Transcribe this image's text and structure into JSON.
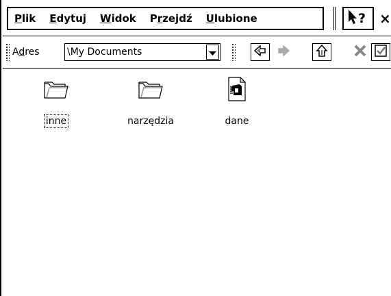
{
  "menu": {
    "items": [
      {
        "first": "P",
        "rest": "lik"
      },
      {
        "first": "E",
        "rest": "dytuj"
      },
      {
        "first": "W",
        "rest": "idok"
      },
      {
        "pre": "P",
        "first": "r",
        "rest": "zejdź"
      },
      {
        "first": "U",
        "rest": "lubione"
      }
    ],
    "help_icon": "help-cursor-icon",
    "close_glyph": "×"
  },
  "address": {
    "label_pre": "A",
    "label_ul": "d",
    "label_post": "res",
    "value": "\\My Documents",
    "dropdown_icon": "chevron-down-icon"
  },
  "toolbar": {
    "buttons": [
      "back-icon",
      "forward-icon",
      "up-folder-icon",
      "delete-icon",
      "properties-icon"
    ]
  },
  "files": [
    {
      "name": "inne",
      "icon": "folder-icon",
      "focused": true
    },
    {
      "name": "narzędzia",
      "icon": "folder-icon",
      "focused": false
    },
    {
      "name": "dane",
      "icon": "document-icon",
      "focused": false
    }
  ]
}
